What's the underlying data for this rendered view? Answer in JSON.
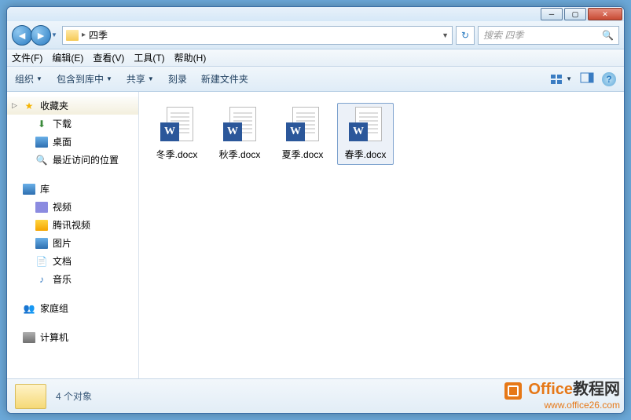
{
  "window": {
    "title": "四季"
  },
  "breadcrumb": {
    "folder": "四季"
  },
  "search": {
    "placeholder": "搜索 四季"
  },
  "menu": {
    "file": "文件(F)",
    "edit": "编辑(E)",
    "view": "查看(V)",
    "tools": "工具(T)",
    "help": "帮助(H)"
  },
  "toolbar": {
    "organize": "组织",
    "include": "包含到库中",
    "share": "共享",
    "burn": "刻录",
    "newfolder": "新建文件夹"
  },
  "sidebar": {
    "favorites": "收藏夹",
    "downloads": "下载",
    "desktop": "桌面",
    "recent": "最近访问的位置",
    "libraries": "库",
    "videos": "视频",
    "tencent": "腾讯视频",
    "pictures": "图片",
    "documents": "文档",
    "music": "音乐",
    "homegroup": "家庭组",
    "computer": "计算机"
  },
  "files": [
    {
      "name": "冬季.docx"
    },
    {
      "name": "秋季.docx"
    },
    {
      "name": "夏季.docx"
    },
    {
      "name": "春季.docx"
    }
  ],
  "status": {
    "count": "4 个对象"
  },
  "watermark": {
    "brand1": "Office",
    "brand2": "教程网",
    "url": "www.office26.com"
  }
}
